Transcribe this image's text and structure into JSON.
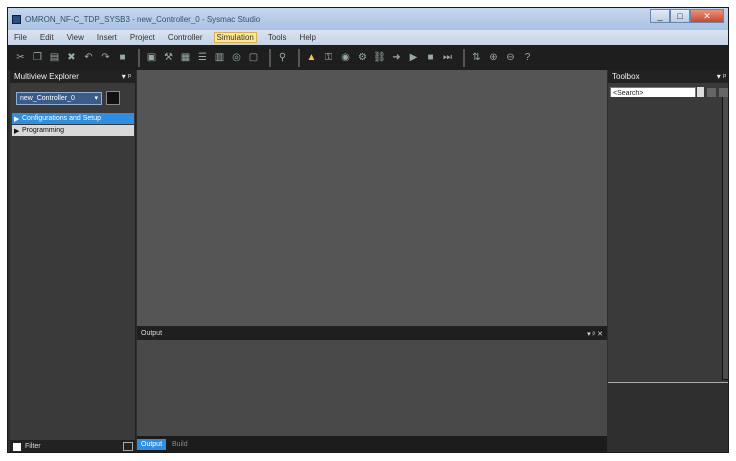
{
  "window": {
    "title": "OMRON_NF-C_TDP_SYSB3 - new_Controller_0 - Sysmac Studio",
    "caption": {
      "minimize": "_",
      "maximize": "□",
      "close": "✕"
    }
  },
  "menubar": {
    "items": [
      "File",
      "Edit",
      "View",
      "Insert",
      "Project",
      "Controller",
      "Simulation",
      "Tools",
      "Help"
    ],
    "active_index": 6
  },
  "toolbar": {
    "icons": [
      "cut-icon",
      "copy-icon",
      "paste-icon",
      "delete-icon",
      "undo-icon",
      "redo-icon",
      "save-icon",
      "sep",
      "panel-icon",
      "tool-icon",
      "grid-icon",
      "list-icon",
      "layers-icon",
      "binoculars-icon",
      "window-icon",
      "sep",
      "search-icon",
      "sep",
      "warning-icon",
      "lock-icon",
      "camera-icon",
      "settings-icon",
      "link-icon",
      "arrow-icon",
      "run-icon",
      "stop-icon",
      "step-icon",
      "sep",
      "transfer-icon",
      "zoom-in-icon",
      "zoom-out-icon",
      "help-icon"
    ]
  },
  "multiview": {
    "title": "Multiview Explorer",
    "pin": "▾ ᵖ",
    "controller": "new_Controller_0",
    "tree": [
      {
        "label": "Configurations and Setup",
        "selected": true
      },
      {
        "label": "Programming",
        "selected": false
      }
    ],
    "filter_label": "Filter"
  },
  "output": {
    "title": "Output",
    "controls": "▾ ᵖ ✕"
  },
  "bottom_tabs": [
    {
      "label": "Output",
      "active": true
    },
    {
      "label": "Build",
      "active": false
    }
  ],
  "toolbox": {
    "title": "Toolbox",
    "pin": "▾ ᵖ",
    "search_placeholder": "<Search>"
  },
  "colors": {
    "accent": "#2f8ee0",
    "titlebar": "#a9c2e3",
    "workspace": "#555555",
    "panel": "#3a3a3a"
  }
}
